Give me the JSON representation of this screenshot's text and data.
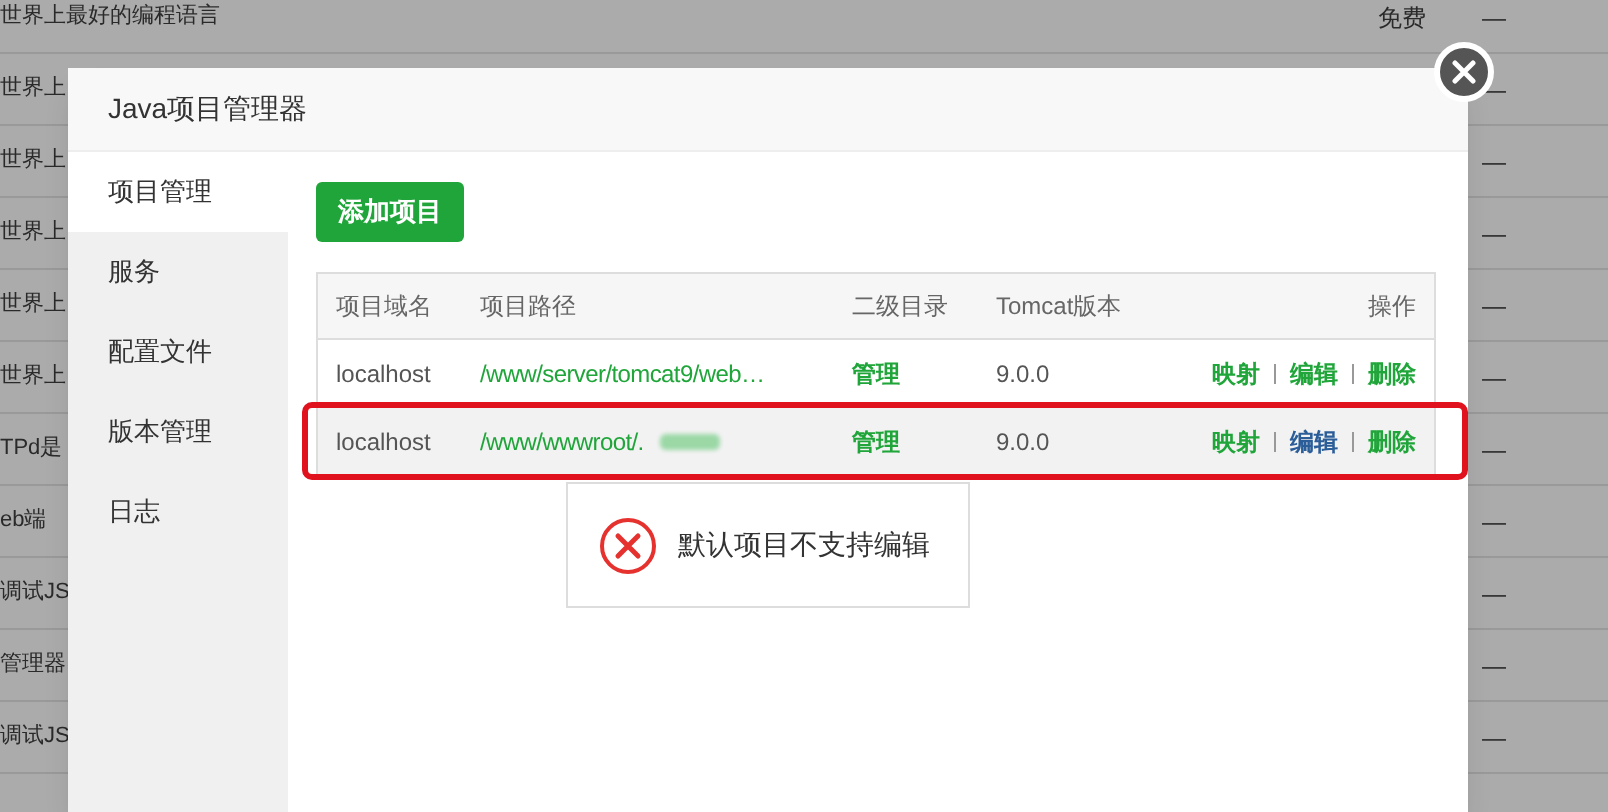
{
  "background": {
    "rows": [
      {
        "text": "世界上最好的编程语言",
        "price": "免费",
        "dash": "—"
      },
      {
        "text": "世界上",
        "dash": "—"
      },
      {
        "text": "世界上",
        "dash": "—"
      },
      {
        "text": "世界上",
        "dash": "—"
      },
      {
        "text": "世界上",
        "dash": "—"
      },
      {
        "text": "世界上",
        "dash": "—"
      },
      {
        "text": "TPd是",
        "dash": "—"
      },
      {
        "text": "eb端",
        "dash": "—"
      },
      {
        "text": "调试JS",
        "dash": "—"
      },
      {
        "text": "管理器",
        "dash": "—"
      },
      {
        "text": "调试JS",
        "dash": "—"
      }
    ]
  },
  "dialog": {
    "title": "Java项目管理器",
    "sidebar": {
      "items": [
        {
          "label": "项目管理",
          "selected": true
        },
        {
          "label": "服务",
          "selected": false
        },
        {
          "label": "配置文件",
          "selected": false
        },
        {
          "label": "版本管理",
          "selected": false
        },
        {
          "label": "日志",
          "selected": false
        }
      ]
    },
    "add_button": "添加项目",
    "table": {
      "columns": [
        "项目域名",
        "项目路径",
        "二级目录",
        "Tomcat版本",
        "操作"
      ],
      "rows": [
        {
          "domain": "localhost",
          "path": "/www/server/tomcat9/web…",
          "path_blurred": false,
          "subdir": "管理",
          "version": "9.0.0",
          "selected": false,
          "highlighted": false,
          "actions": [
            {
              "label": "映射",
              "color": "#20a53a"
            },
            {
              "label": "编辑",
              "color": "#20a53a"
            },
            {
              "label": "删除",
              "color": "#20a53a"
            }
          ]
        },
        {
          "domain": "localhost",
          "path": "/www/wwwroot/.",
          "path_blurred": true,
          "subdir": "管理",
          "version": "9.0.0",
          "selected": true,
          "highlighted": true,
          "actions": [
            {
              "label": "映射",
              "color": "#20a53a"
            },
            {
              "label": "编辑",
              "color": "#2b5d98"
            },
            {
              "label": "删除",
              "color": "#20a53a"
            }
          ]
        }
      ]
    },
    "toast": {
      "message": "默认项目不支持编辑"
    }
  }
}
